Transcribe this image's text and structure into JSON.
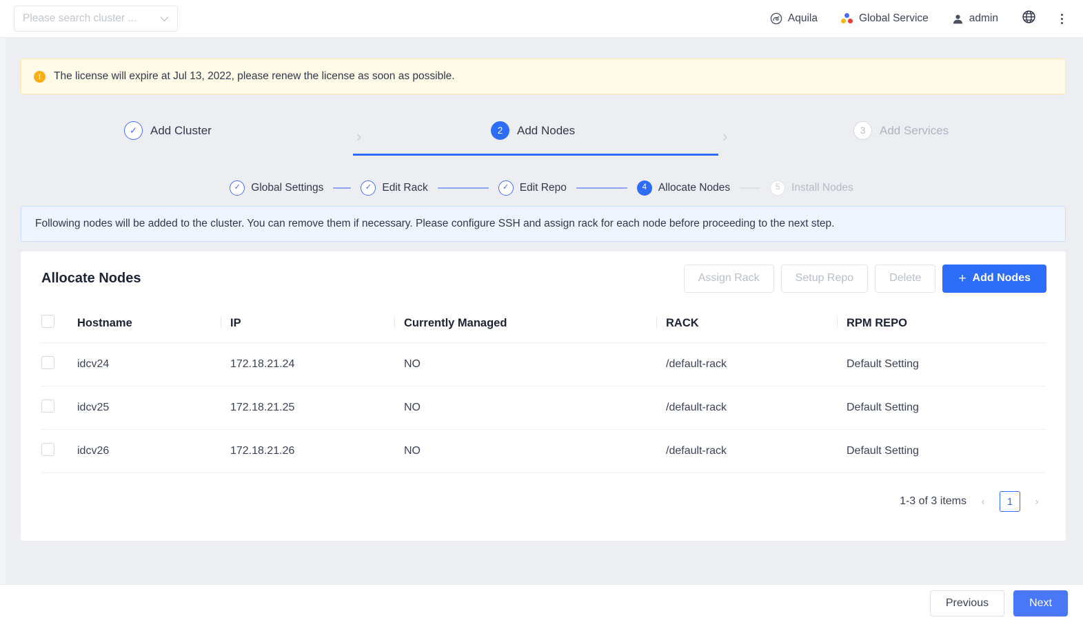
{
  "topbar": {
    "cluster_search_placeholder": "Please search cluster ...",
    "items": [
      {
        "label": "Aquila",
        "icon": "aquila-icon"
      },
      {
        "label": "Global Service",
        "icon": "global-service-icon"
      },
      {
        "label": "admin",
        "icon": "user-icon"
      }
    ],
    "globe_icon": "globe-icon",
    "more_icon": "kebab-menu-icon"
  },
  "license_banner": {
    "icon": "warning-icon",
    "text": "The license will expire at Jul 13, 2022, please renew the license as soon as possible."
  },
  "stepper": {
    "steps": [
      {
        "number": "✓",
        "label": "Add Cluster",
        "state": "done"
      },
      {
        "number": "2",
        "label": "Add Nodes",
        "state": "active"
      },
      {
        "number": "3",
        "label": "Add Services",
        "state": "todo"
      }
    ],
    "separator": "›"
  },
  "substeps": [
    {
      "number": "✓",
      "label": "Global Settings",
      "state": "done"
    },
    {
      "number": "✓",
      "label": "Edit Rack",
      "state": "done"
    },
    {
      "number": "✓",
      "label": "Edit Repo",
      "state": "done"
    },
    {
      "number": "4",
      "label": "Allocate Nodes",
      "state": "active"
    },
    {
      "number": "5",
      "label": "Install Nodes",
      "state": "todo"
    }
  ],
  "info_banner": {
    "text": "Following nodes will be added to the cluster. You can remove them if necessary. Please configure SSH and assign rack for each node before proceeding to the next step."
  },
  "card": {
    "title": "Allocate Nodes",
    "buttons": {
      "assign_rack": "Assign Rack",
      "setup_repo": "Setup Repo",
      "delete": "Delete",
      "add_nodes": "Add Nodes",
      "add_nodes_plus": "+"
    },
    "table": {
      "columns": [
        "Hostname",
        "IP",
        "Currently Managed",
        "RACK",
        "RPM REPO"
      ],
      "rows": [
        {
          "hostname": "idcv24",
          "ip": "172.18.21.24",
          "managed": "NO",
          "rack": "/default-rack",
          "repo": "Default Setting"
        },
        {
          "hostname": "idcv25",
          "ip": "172.18.21.25",
          "managed": "NO",
          "rack": "/default-rack",
          "repo": "Default Setting"
        },
        {
          "hostname": "idcv26",
          "ip": "172.18.21.26",
          "managed": "NO",
          "rack": "/default-rack",
          "repo": "Default Setting"
        }
      ]
    },
    "pagination": {
      "summary": "1-3 of 3 items",
      "prev": "‹",
      "page": "1",
      "next": "›"
    }
  },
  "footer": {
    "previous": "Previous",
    "next": "Next"
  },
  "colors": {
    "accent_blue": "#2d6cf6",
    "footer_blue": "#4a77f5",
    "warning_yellow": "#faad14",
    "license_bg": "#fffbe8",
    "info_bg": "#eef5fe",
    "page_bg": "#eceef2"
  }
}
